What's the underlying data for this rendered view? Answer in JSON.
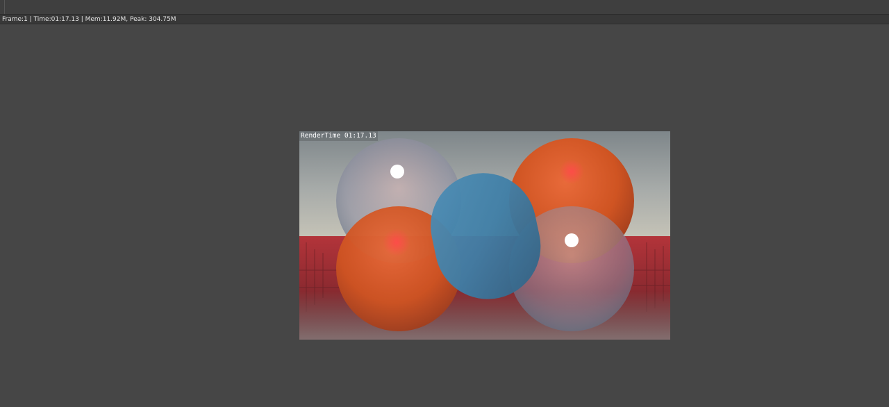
{
  "status_bar": {
    "text": "Frame:1 | Time:01:17.13 | Mem:11.92M, Peak: 304.75M"
  },
  "render_result": {
    "stamp": "RenderTime 01:17.13"
  },
  "colors": {
    "background": "#464646",
    "statusbar": "#383838",
    "topbar": "#3f3f3f"
  }
}
